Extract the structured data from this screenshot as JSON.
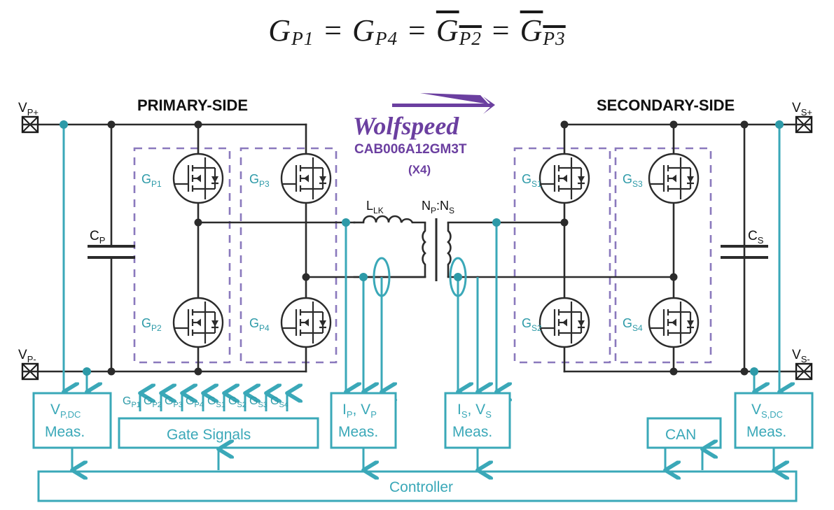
{
  "equation": {
    "t1": "G",
    "s1": "P1",
    "eq1": "=",
    "t2": "G",
    "s2": "P4",
    "eq2": "=",
    "t3": "G",
    "s3": "P2",
    "eq3": "=",
    "t4": "G",
    "s4": "P3"
  },
  "headers": {
    "primary": "PRIMARY-SIDE",
    "secondary": "SECONDARY-SIDE"
  },
  "brand": {
    "name": "Wolfspeed",
    "registered": ".",
    "part_number": "CAB006A12GM3T",
    "quantity": "(X4)",
    "color": "#6b3fa0"
  },
  "terminals": {
    "vp_plus": "V",
    "vp_plus_sub": "P+",
    "vp_minus": "V",
    "vp_minus_sub": "P-",
    "vs_plus": "V",
    "vs_plus_sub": "S+",
    "vs_minus": "V",
    "vs_minus_sub": "S-"
  },
  "capacitors": {
    "cp": "C",
    "cp_sub": "P",
    "cs": "C",
    "cs_sub": "S"
  },
  "transformer": {
    "lk": "L",
    "lk_sub": "LK",
    "ratio_a": "N",
    "ratio_a_sub": "P",
    "ratio_colon": ":",
    "ratio_b": "N",
    "ratio_b_sub": "S"
  },
  "mosfets": [
    {
      "id": "gp1",
      "letter": "G",
      "sub": "P1"
    },
    {
      "id": "gp2",
      "letter": "G",
      "sub": "P2"
    },
    {
      "id": "gp3",
      "letter": "G",
      "sub": "P3"
    },
    {
      "id": "gp4",
      "letter": "G",
      "sub": "P4"
    },
    {
      "id": "gs1",
      "letter": "G",
      "sub": "S1"
    },
    {
      "id": "gs2",
      "letter": "G",
      "sub": "S2"
    },
    {
      "id": "gs3",
      "letter": "G",
      "sub": "S3"
    },
    {
      "id": "gs4",
      "letter": "G",
      "sub": "S4"
    }
  ],
  "gate_signal_labels": [
    {
      "letter": "G",
      "sub": "P1"
    },
    {
      "letter": "G",
      "sub": "P2"
    },
    {
      "letter": "G",
      "sub": "P3"
    },
    {
      "letter": "G",
      "sub": "P4"
    },
    {
      "letter": "G",
      "sub": "S1"
    },
    {
      "letter": "G",
      "sub": "S2"
    },
    {
      "letter": "G",
      "sub": "S3"
    },
    {
      "letter": "G",
      "sub": "S4"
    }
  ],
  "blocks": {
    "vp_dc_line1": "V",
    "vp_dc_line1_sub": "P,DC",
    "vp_dc_line2": "Meas.",
    "gate_signals": "Gate Signals",
    "ip_vp_l1a": "I",
    "ip_vp_l1a_sub": "P",
    "ip_vp_l1b": ", V",
    "ip_vp_l1b_sub": "P",
    "ip_vp_l2": "Meas.",
    "is_vs_l1a": "I",
    "is_vs_l1a_sub": "S",
    "is_vs_l1b": ", V",
    "is_vs_l1b_sub": "S",
    "is_vs_l2": "Meas.",
    "can": "CAN",
    "vs_dc_line1": "V",
    "vs_dc_line1_sub": "S,DC",
    "vs_dc_line2": "Meas.",
    "controller": "Controller"
  },
  "colors": {
    "teal": "#3aa8b8",
    "teal_dark": "#2d9aa8",
    "purple": "#8a79bd",
    "wire": "#2b2b2b",
    "background": "#ffffff"
  }
}
